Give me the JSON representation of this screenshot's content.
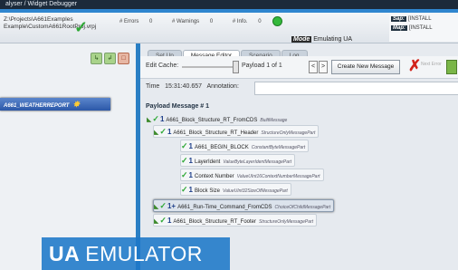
{
  "window": {
    "title": "alyser / Widget Debugger"
  },
  "header": {
    "path_line1": "Z:\\Projects\\A661Examples",
    "path_line2": "Example\\CustomA661RootProj.vrpj",
    "errors": "# Errors",
    "errors_count": "0",
    "warnings": "# Warnings",
    "warnings_count": "0",
    "info": "# Info.",
    "info_count": "0",
    "mode_label": "Mode",
    "mode_value": "Emulating UA",
    "sap_label": "Sap:",
    "sap_value": "[INSTALL",
    "map_label": "Map:",
    "map_value": "[INSTALL"
  },
  "left": {
    "selected_item": "A661_WEATHERREPORT"
  },
  "tabs": [
    {
      "label": "Set Up"
    },
    {
      "label": "Message Editor"
    },
    {
      "label": "Scenario"
    },
    {
      "label": "Log"
    }
  ],
  "editor": {
    "edit_cache": "Edit Cache:",
    "payload_label": "Payload  1  of  1",
    "prev": "<",
    "next": ">",
    "new_message": "Create New Message",
    "next_error": "Next Error",
    "time_label": "Time",
    "time_value": "15:31:40.657",
    "annotation_label": "Annotation:",
    "payload_message": "Payload Message # 1"
  },
  "tree": [
    {
      "name": "A661_Block_Structure_RT_FromCDS",
      "type": "BuiltMessage"
    },
    {
      "name": "A661_Block_Structure_RT_Header",
      "type": "StructureOnlyMessagePart"
    },
    {
      "name": "A661_BEGIN_BLOCK",
      "type": "ConstantByteMessagePart"
    },
    {
      "name": "LayerIdent",
      "type": "ValueByteLayerIdentMessagePart"
    },
    {
      "name": "Context Number",
      "type": "ValueUInt16ContextNumberMessagePart"
    },
    {
      "name": "Block Size",
      "type": "ValueUInt32SizeOfMessagePart"
    },
    {
      "name": "A661_Run-Time_Command_FromCDS",
      "type": "ChoiceOfChildMessagePart",
      "prefix": "1+"
    },
    {
      "name": "A661_Block_Structure_RT_Footer",
      "type": "StructureOnlyMessagePart"
    }
  ],
  "banner": {
    "bold": "UA",
    "rest": "EMULATOR"
  }
}
